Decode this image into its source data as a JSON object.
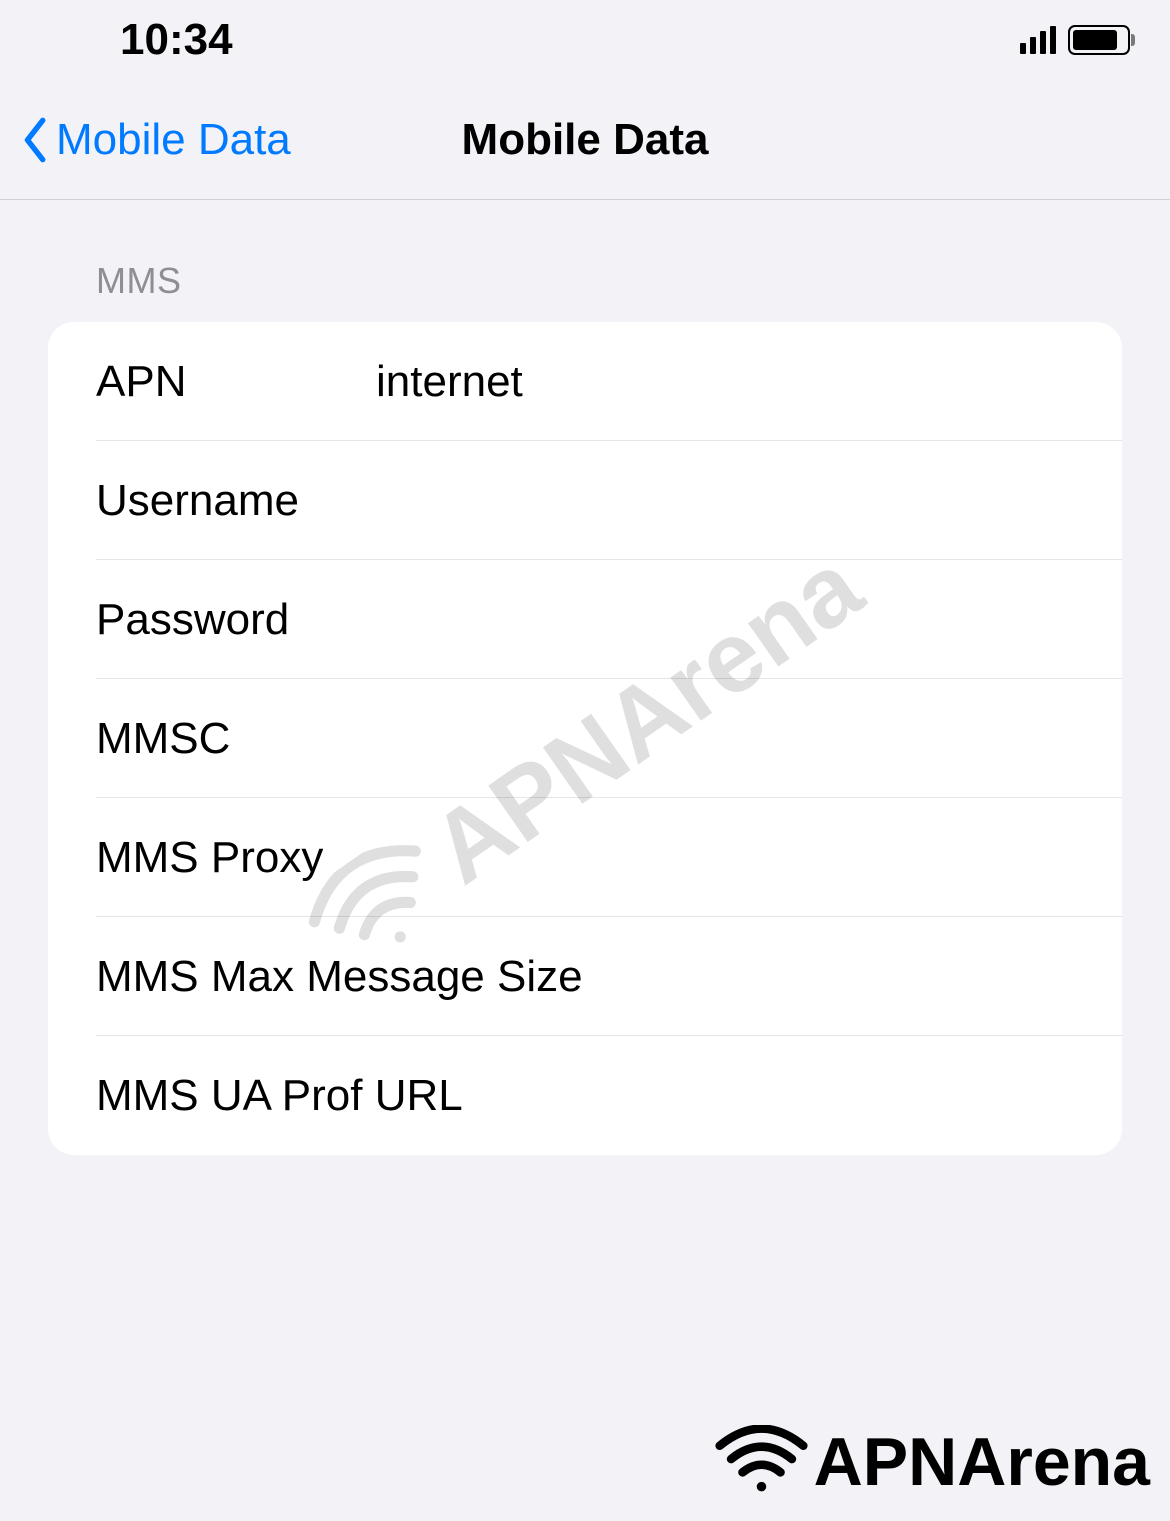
{
  "status_bar": {
    "time": "10:34"
  },
  "nav": {
    "back_label": "Mobile Data",
    "title": "Mobile Data"
  },
  "section": {
    "header": "MMS"
  },
  "fields": {
    "apn": {
      "label": "APN",
      "value": "internet"
    },
    "username": {
      "label": "Username",
      "value": ""
    },
    "password": {
      "label": "Password",
      "value": ""
    },
    "mmsc": {
      "label": "MMSC",
      "value": ""
    },
    "mms_proxy": {
      "label": "MMS Proxy",
      "value": ""
    },
    "mms_max_message_size": {
      "label": "MMS Max Message Size",
      "value": ""
    },
    "mms_ua_prof_url": {
      "label": "MMS UA Prof URL",
      "value": ""
    }
  },
  "watermark": {
    "text": "APNArena"
  },
  "footer": {
    "brand": "APNArena"
  }
}
